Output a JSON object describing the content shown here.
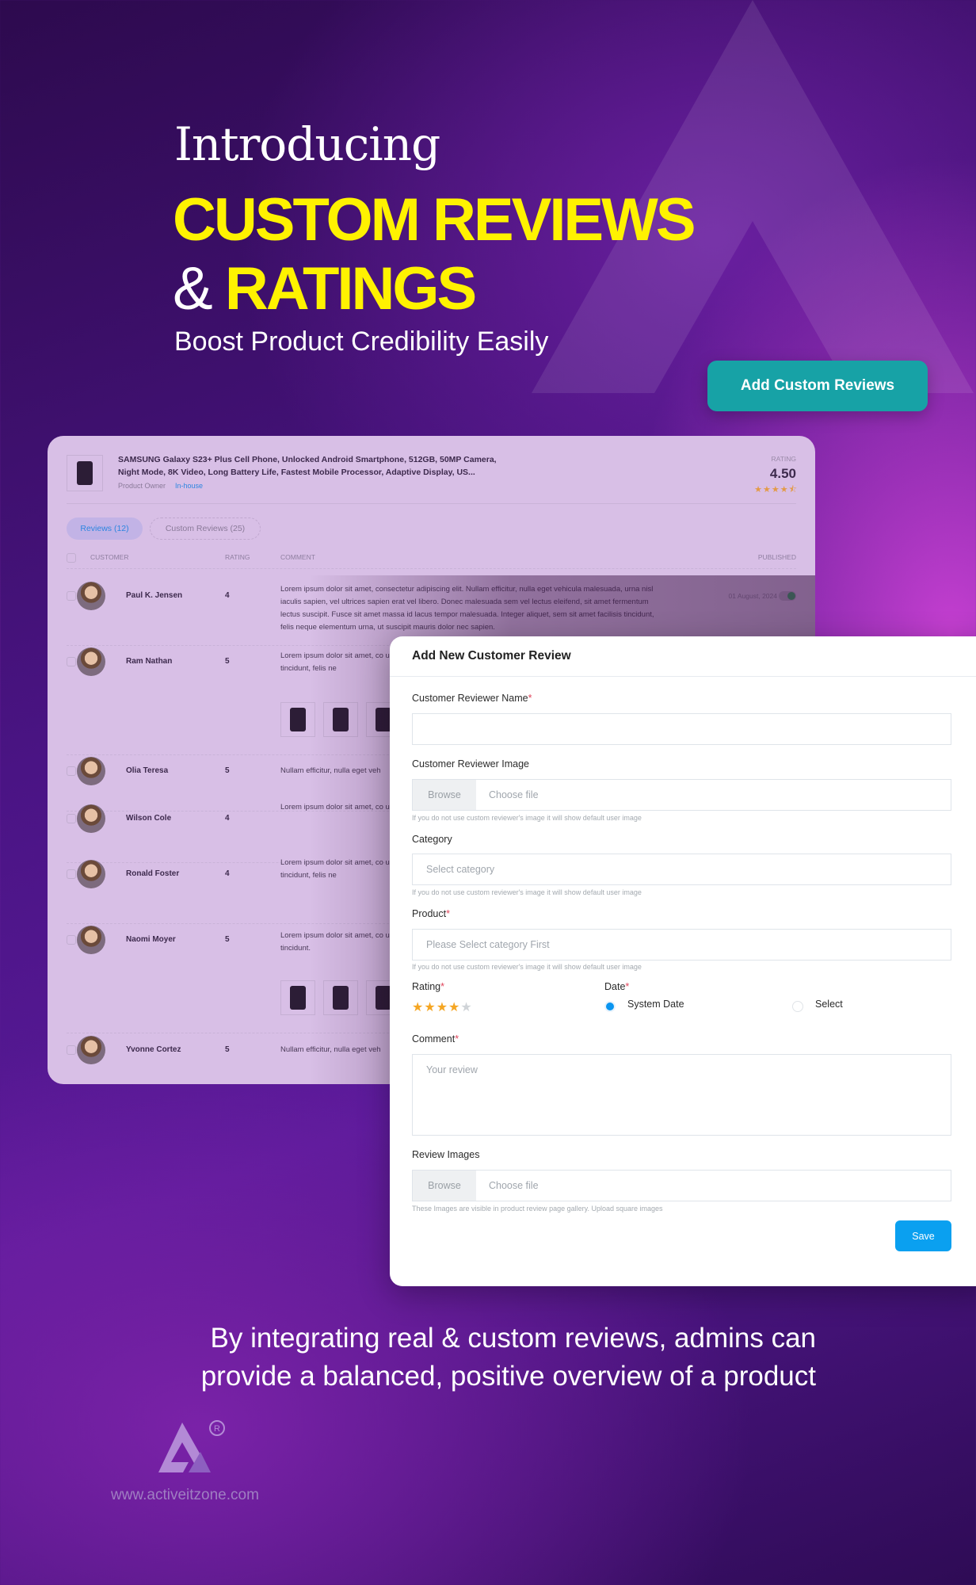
{
  "hero": {
    "intro": "Introducing",
    "line1": "CUSTOM REVIEWS",
    "amp": "&",
    "line2": "RATINGS",
    "subtitle": "Boost Product Credibility Easily",
    "cta_label": "Add Custom Reviews"
  },
  "colors": {
    "accent_yellow": "#fff200",
    "cta_teal": "#17a2a6",
    "save_blue": "#0aa0f0",
    "star": "#f5a623"
  },
  "product_panel": {
    "title": "SAMSUNG Galaxy S23+ Plus Cell Phone, Unlocked Android Smartphone, 512GB, 50MP Camera, Night Mode, 8K Video, Long Battery Life, Fastest Mobile Processor, Adaptive Display, US...",
    "owner_label": "Product Owner",
    "owner_value": "In-house",
    "rating_label": "RATING",
    "rating_value": "4.50",
    "rating_stars": 4.5,
    "tabs": [
      {
        "label": "Reviews (12)",
        "active": true
      },
      {
        "label": "Custom Reviews (25)",
        "active": false
      }
    ],
    "columns": {
      "customer": "CUSTOMER",
      "rating": "RATING",
      "comment": "COMMENT",
      "published": "PUBLISHED"
    },
    "rows": [
      {
        "name": "Paul K. Jensen",
        "rating": "4",
        "comment": "Lorem ipsum dolor sit amet, consectetur adipiscing elit. Nullam efficitur, nulla eget vehicula malesuada, urna nisl iaculis sapien, vel ultrices sapien erat vel libero. Donec malesuada sem vel lectus eleifend, sit amet fermentum lectus suscipit. Fusce sit amet massa id lacus tempor malesuada. Integer aliquet, sem sit amet facilisis tincidunt, felis neque elementum urna, ut suscipit mauris dolor nec sapien.",
        "published": "01 August, 2024",
        "toggle_on": true
      },
      {
        "name": "Ram Nathan",
        "rating": "5",
        "comment": "Lorem ipsum dolor sit amet, co urna nisl iaculis sapien, vel ultr amet fermentum lectus suscip amet facilisis tincidunt, felis ne"
      },
      {
        "name": "Olia Teresa",
        "rating": "5",
        "comment": "Nullam efficitur, nulla eget veh"
      },
      {
        "name": "Wilson Cole",
        "rating": "4",
        "comment": "Lorem ipsum dolor sit amet, co urna nisl iaculis sapien, vel ultr amet fermentum lectus suscip"
      },
      {
        "name": "Ronald Foster",
        "rating": "4",
        "comment": "Lorem ipsum dolor sit amet, co urna nisl iaculis sapien, vel ultr amet fermentum lectus suscip amet facilisis tincidunt, felis ne"
      },
      {
        "name": "Naomi Moyer",
        "rating": "5",
        "comment": "Lorem ipsum dolor sit amet, co urna nisl iaculis sapien, vel ultr amet fermentum lectus suscip amet facilisis tincidunt."
      },
      {
        "name": "Yvonne Cortez",
        "rating": "5",
        "comment": "Nullam efficitur, nulla eget veh"
      }
    ]
  },
  "form": {
    "title": "Add New Customer Review",
    "name_label": "Customer Reviewer Name",
    "name_value": "",
    "image_label": "Customer Reviewer Image",
    "browse_label": "Browse",
    "choose_file": "Choose file",
    "image_hint": "If you do not use custom reviewer's image it will show default user image",
    "category_label": "Category",
    "category_placeholder": "Select category",
    "category_hint": "If you do not use custom reviewer's image it will show default user image",
    "product_label": "Product",
    "product_placeholder": "Please Select category First",
    "product_hint": "If you do not use custom reviewer's image it will show default user image",
    "rating_label": "Rating",
    "rating_value": 4.5,
    "date_label": "Date",
    "date_options": [
      {
        "label": "System Date",
        "selected": true
      },
      {
        "label": "Select",
        "selected": false
      }
    ],
    "comment_label": "Comment",
    "comment_placeholder": "Your review",
    "review_images_label": "Review Images",
    "review_images_hint": "These Images are visible in product review page gallery. Upload square images",
    "required_mark": "*",
    "save_label": "Save"
  },
  "footer": {
    "text": "By integrating real & custom reviews, admins can provide a balanced, positive overview of a product",
    "url": "www.activeitzone.com"
  }
}
